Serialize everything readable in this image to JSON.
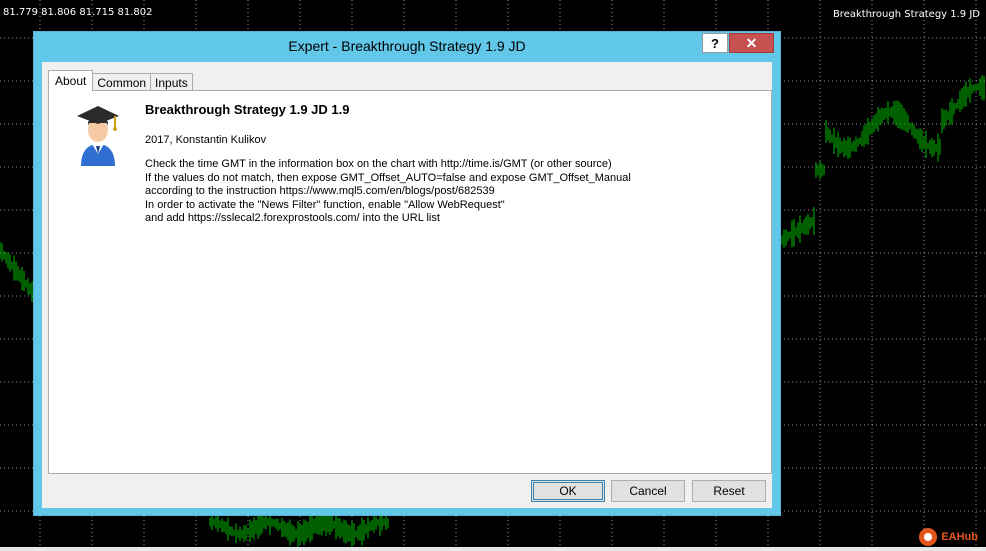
{
  "chart": {
    "price_readout": "81.779 81.806 81.715 81.802",
    "symbol_label": "Breakthrough Strategy 1.9 JD",
    "watermark": "EAHub",
    "colors": {
      "background": "#000000",
      "bars": "#00c000",
      "grid": "#ffffff"
    }
  },
  "dialog": {
    "title": "Expert - Breakthrough Strategy 1.9 JD",
    "help_label": "?",
    "close_label": "✕",
    "tabs": [
      {
        "label": "About",
        "active": true
      },
      {
        "label": "Common",
        "active": false
      },
      {
        "label": "Inputs",
        "active": false
      }
    ],
    "about": {
      "icon": "expert-graduate-icon",
      "name": "Breakthrough Strategy 1.9 JD 1.9",
      "author": "2017, Konstantin Kulikov",
      "description": [
        "Check the time GMT in the information box on the chart with http://time.is/GMT (or other source)",
        "If the values do not match, then expose GMT_Offset_AUTO=false and expose GMT_Offset_Manual",
        "according to the instruction https://www.mql5.com/en/blogs/post/682539",
        "In order to activate the \"News Filter\" function, enable \"Allow WebRequest\"",
        "and add https://sslecal2.forexprostools.com/ into the URL list"
      ]
    },
    "buttons": {
      "ok": "OK",
      "cancel": "Cancel",
      "reset": "Reset"
    },
    "colors": {
      "frame": "#62c8ea",
      "close": "#c75050"
    }
  }
}
